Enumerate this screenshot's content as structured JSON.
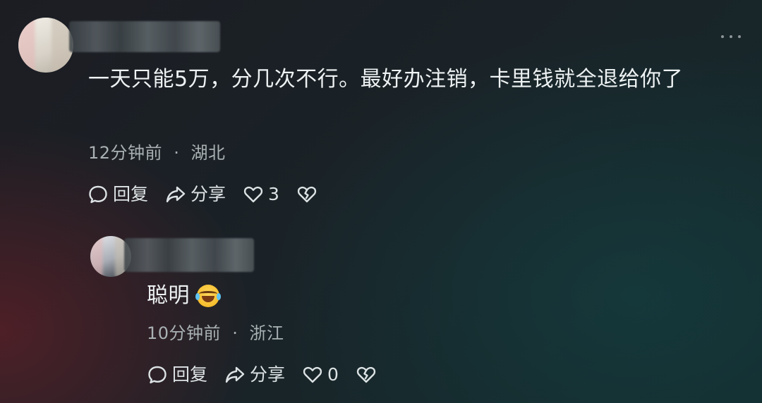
{
  "comment": {
    "text": "一天只能5万，分几次不行。最好办注销，卡里钱就全退给你了",
    "time": "12分钟前",
    "separator": "·",
    "location": "湖北",
    "reply_label": "回复",
    "share_label": "分享",
    "like_count": "3"
  },
  "reply": {
    "text": "聪明",
    "emoji": "laugh-cry-emoji",
    "time": "10分钟前",
    "separator": "·",
    "location": "浙江",
    "reply_label": "回复",
    "share_label": "分享",
    "like_count": "0"
  },
  "icons": {
    "more": "more-dots-icon",
    "reply": "comment-bubble-icon",
    "share": "share-arrow-icon",
    "like": "heart-icon",
    "dislike": "broken-heart-icon"
  },
  "colors": {
    "text": "#eef2f3",
    "meta": "#a9b1b3"
  }
}
